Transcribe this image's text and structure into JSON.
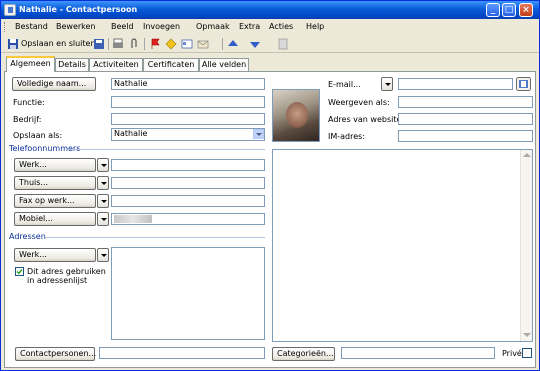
{
  "window": {
    "title": "Nathalie - Contactpersoon"
  },
  "menu": [
    "Bestand",
    "Bewerken",
    "Beeld",
    "Invoegen",
    "Opmaak",
    "Extra",
    "Acties",
    "Help"
  ],
  "toolbar": {
    "save_close_label": "Opslaan en sluiten"
  },
  "tabs": [
    "Algemeen",
    "Details",
    "Activiteiten",
    "Certificaten",
    "Alle velden"
  ],
  "form": {
    "full_name_button": "Volledige naam...",
    "full_name_value": "Nathalie",
    "function_label": "Functie:",
    "company_label": "Bedrijf:",
    "file_as_label": "Opslaan als:",
    "file_as_value": "Nathalie",
    "email_label": "E-mail...",
    "display_as_label": "Weergeven als:",
    "website_label": "Adres van website:",
    "im_label": "IM-adres:"
  },
  "phones": {
    "section_title": "Telefoonnummers",
    "items": [
      "Werk...",
      "Thuis...",
      "Fax op werk...",
      "Mobiel..."
    ]
  },
  "addresses": {
    "section_title": "Adressen",
    "type_button": "Werk...",
    "mailing_checkbox_label": "Dit adres gebruiken in adressenlijst",
    "mailing_checked": true
  },
  "footer": {
    "contacts_button": "Contactpersonen...",
    "categories_button": "Categorieën...",
    "private_label": "Privé",
    "private_checked": false
  }
}
